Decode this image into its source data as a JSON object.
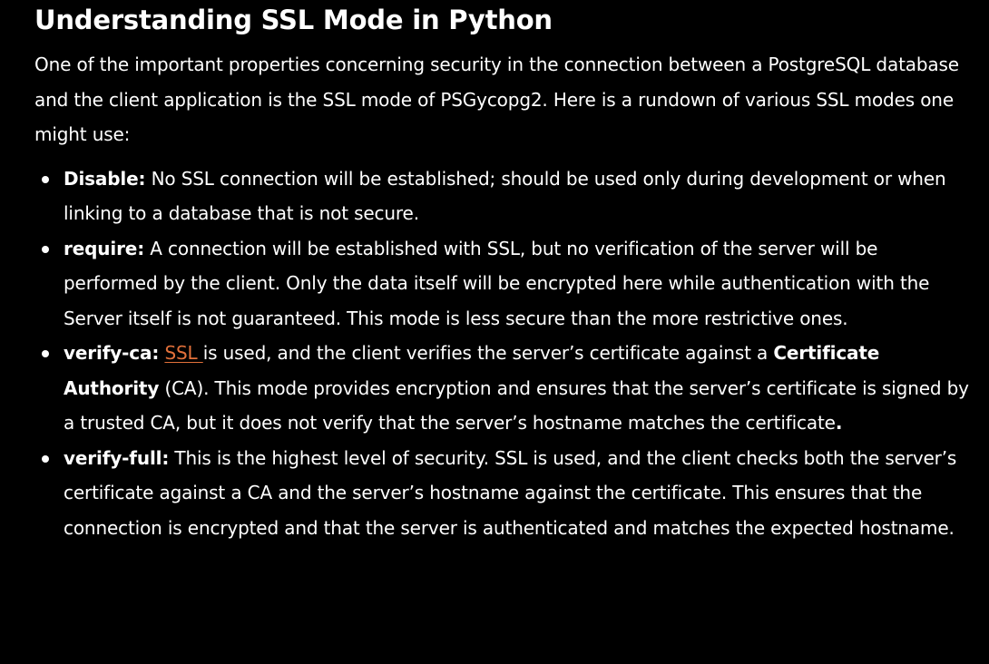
{
  "article": {
    "title": "Understanding SSL Mode in Python",
    "intro": "One of the important properties concerning security in the connection between a PostgreSQL database and the client application is the SSL mode of PSGycopg2. Here is a rundown of various SSL modes one might use:",
    "modes": [
      {
        "term": "Disable:",
        "text": " No SSL connection will be established; should be used only during development or when linking to a database that is not secure."
      },
      {
        "term": "require:",
        "text": " A connection will be established with SSL, but no verification of the server will be performed by the client. Only the data itself will be encrypted here while authentication with the Server itself is not guaranteed. This mode is less secure than the more restrictive ones."
      },
      {
        "term": "verify-ca:",
        "link": "SSL ",
        "text_a": "is used, and the client verifies the server’s certificate against a ",
        "bold": "Certificate Authority",
        "text_b": " (CA). This mode provides encryption and ensures that the server’s certificate is signed by a trusted CA, but it does not verify that the server’s hostname matches the certificate",
        "end": "."
      },
      {
        "term": "verify-full:",
        "text": " This is the highest level of security. SSL is used, and the client checks both the server’s certificate against a CA and the server’s hostname against the certificate. This ensures that the connection is encrypted and that the server is authenticated and matches the expected hostname."
      }
    ]
  },
  "colors": {
    "background": "#000000",
    "text": "#ffffff",
    "link": "#e2703a"
  }
}
